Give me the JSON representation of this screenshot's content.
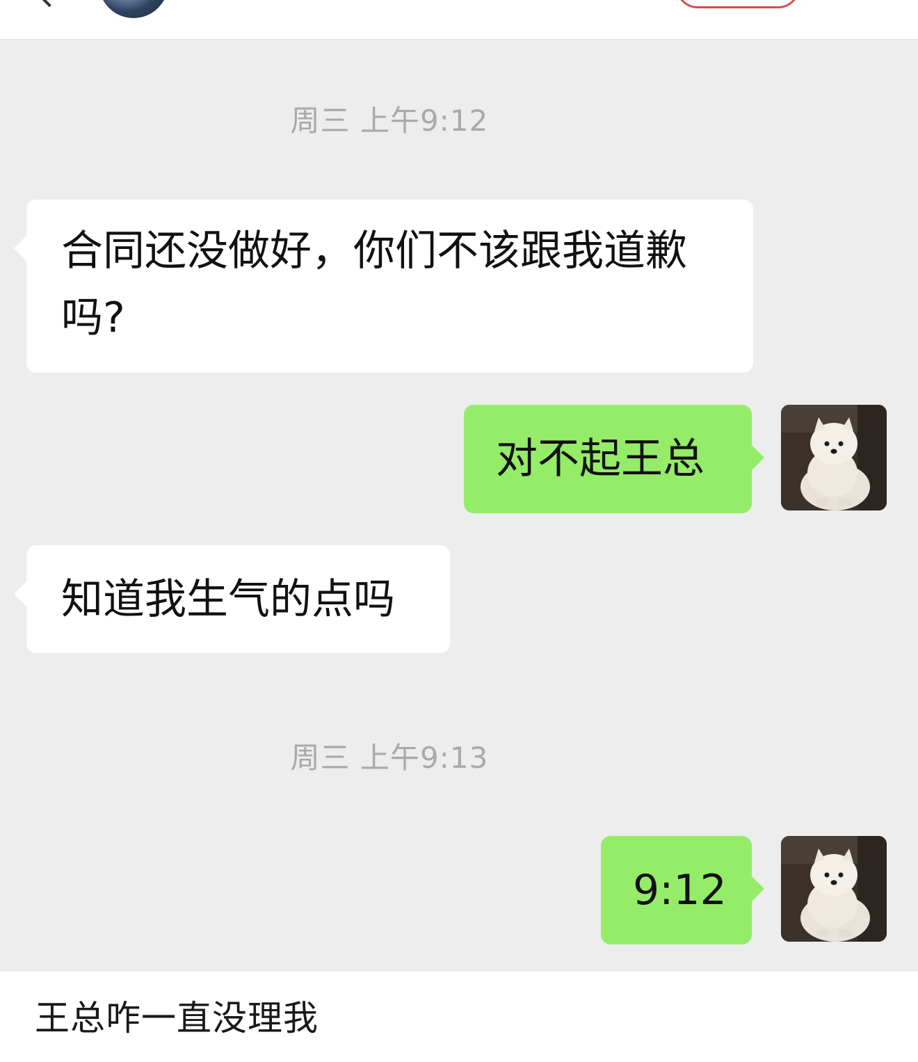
{
  "header": {
    "back_icon": "back-arrow-icon",
    "more_icon": "more-icon"
  },
  "messages": [
    {
      "type": "timestamp",
      "text": "周三 上午9:12"
    },
    {
      "type": "received",
      "text": "合同还没做好，你们不该跟我道歉吗?"
    },
    {
      "type": "sent",
      "text": "对不起王总",
      "avatar": "samoyed-puppy-avatar"
    },
    {
      "type": "received",
      "text": "知道我生气的点吗"
    },
    {
      "type": "timestamp",
      "text": "周三 上午9:13"
    },
    {
      "type": "sent",
      "text": "9:12",
      "avatar": "samoyed-puppy-avatar"
    }
  ],
  "input": {
    "value": "王总咋一直没理我"
  },
  "colors": {
    "chat_background": "#ededed",
    "sent_bubble": "#95ec69",
    "received_bubble": "#ffffff",
    "timestamp_text": "#a9a9a9"
  }
}
